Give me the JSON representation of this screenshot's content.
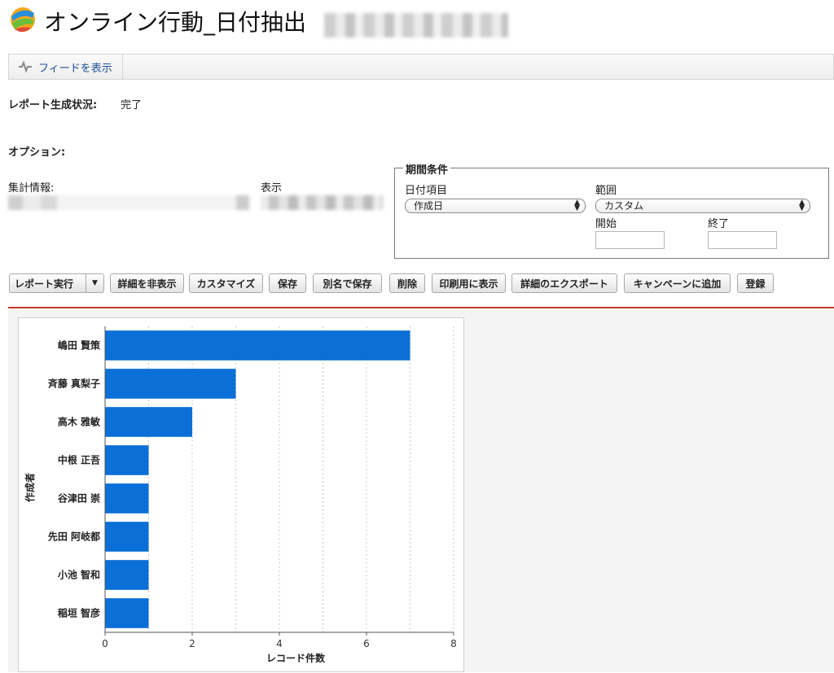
{
  "header": {
    "title": "オンライン行動_日付抽出"
  },
  "feedbar": {
    "feed_label": "フィードを表示"
  },
  "status": {
    "label": "レポート生成状況:",
    "value": "完了"
  },
  "options": {
    "label": "オプション:"
  },
  "summary": {
    "label": "集計情報:"
  },
  "display": {
    "label": "表示"
  },
  "period": {
    "legend": "期間条件",
    "date_field_label": "日付項目",
    "date_field_value": "作成日",
    "range_label": "範囲",
    "range_value": "カスタム",
    "start_label": "開始",
    "end_label": "終了",
    "start_value": "",
    "end_value": ""
  },
  "toolbar": {
    "run": "レポート実行",
    "hide_details": "詳細を非表示",
    "customize": "カスタマイズ",
    "save": "保存",
    "save_as": "別名で保存",
    "delete": "削除",
    "print": "印刷用に表示",
    "export": "詳細のエクスポート",
    "add_campaign": "キャンペーンに追加",
    "subscribe": "登録"
  },
  "colors": {
    "bar": "#0a6fd6",
    "accent_line": "#c0392b",
    "link": "#1a4f95"
  },
  "chart_data": {
    "type": "bar",
    "orientation": "horizontal",
    "categories": [
      "嶋田 賢策",
      "斉藤 真梨子",
      "高木 雅敏",
      "中根 正吾",
      "谷津田 崇",
      "先田 阿岐都",
      "小池 智和",
      "稲垣 智彦"
    ],
    "values": [
      7,
      3,
      2,
      1,
      1,
      1,
      1,
      1
    ],
    "xlabel": "レコード件数",
    "ylabel": "作成者",
    "xlim": [
      0,
      8
    ],
    "xticks": [
      0,
      2,
      4,
      6,
      8
    ],
    "grid": "vertical dashed"
  }
}
